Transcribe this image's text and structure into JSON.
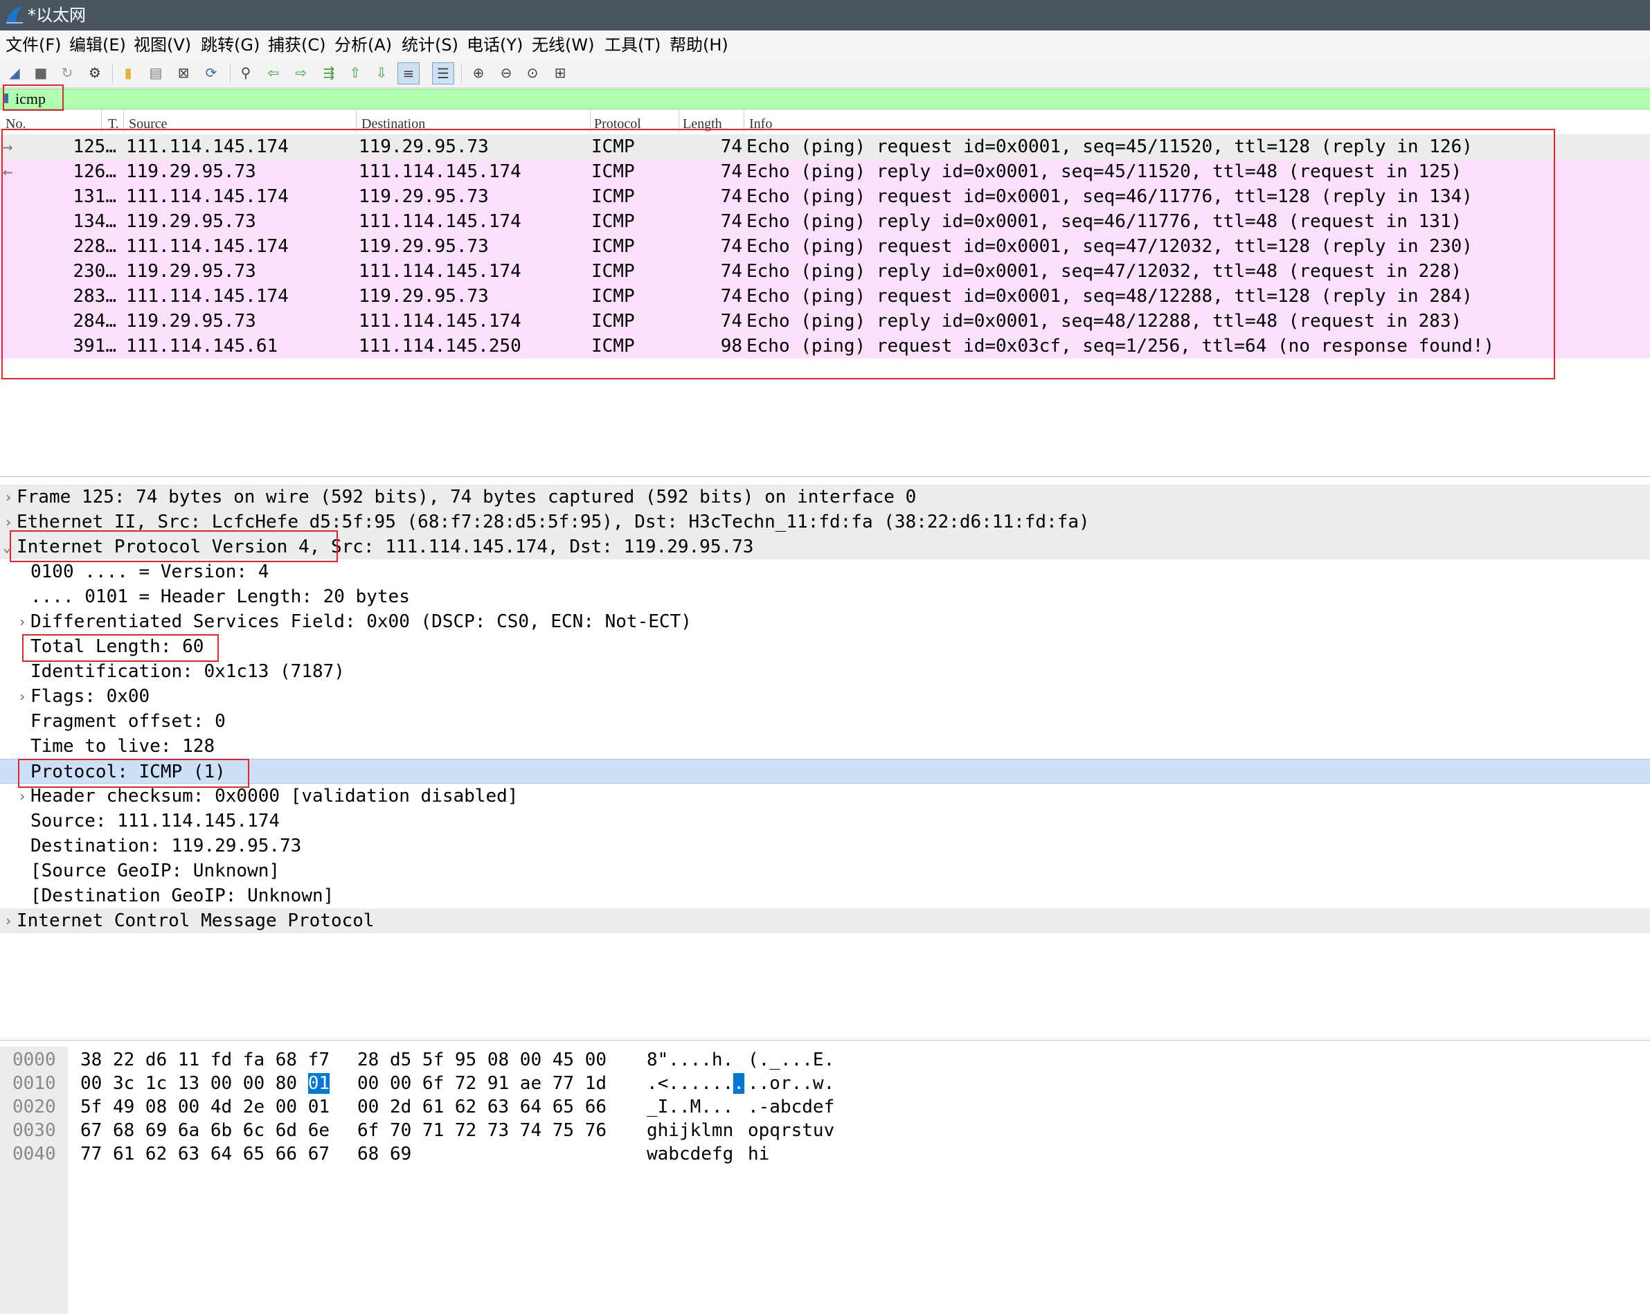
{
  "window": {
    "title": "*以太网"
  },
  "menu": [
    "文件(F)",
    "编辑(E)",
    "视图(V)",
    "跳转(G)",
    "捕获(C)",
    "分析(A)",
    "统计(S)",
    "电话(Y)",
    "无线(W)",
    "工具(T)",
    "帮助(H)"
  ],
  "toolbar": {
    "buttons": [
      "shark-fin-start-icon",
      "stop-capture-icon",
      "restart-capture-icon",
      "capture-options-icon",
      "open-file-icon",
      "save-file-icon",
      "close-file-icon",
      "reload-file-icon",
      "find-packet-icon",
      "go-back-icon",
      "go-forward-icon",
      "go-to-packet-icon",
      "first-packet-icon",
      "last-packet-icon",
      "autoscroll-icon",
      "colorize-icon",
      "zoom-in-icon",
      "zoom-out-icon",
      "normal-size-icon",
      "resize-columns-icon"
    ]
  },
  "filter": {
    "value": "icmp"
  },
  "packet_list": {
    "columns": [
      "No.",
      "T.",
      "Source",
      "Destination",
      "Protocol",
      "Length",
      "Info"
    ],
    "rows": [
      {
        "arrow": "→",
        "no": "125…",
        "source": "111.114.145.174",
        "destination": "119.29.95.73",
        "protocol": "ICMP",
        "length": "74",
        "info": "Echo (ping) request  id=0x0001, seq=45/11520, ttl=128 (reply in 126)"
      },
      {
        "arrow": "←",
        "no": "126…",
        "source": "119.29.95.73",
        "destination": "111.114.145.174",
        "protocol": "ICMP",
        "length": "74",
        "info": "Echo (ping) reply    id=0x0001, seq=45/11520, ttl=48 (request in 125)"
      },
      {
        "arrow": "",
        "no": "131…",
        "source": "111.114.145.174",
        "destination": "119.29.95.73",
        "protocol": "ICMP",
        "length": "74",
        "info": "Echo (ping) request  id=0x0001, seq=46/11776, ttl=128 (reply in 134)"
      },
      {
        "arrow": "",
        "no": "134…",
        "source": "119.29.95.73",
        "destination": "111.114.145.174",
        "protocol": "ICMP",
        "length": "74",
        "info": "Echo (ping) reply    id=0x0001, seq=46/11776, ttl=48 (request in 131)"
      },
      {
        "arrow": "",
        "no": "228…",
        "source": "111.114.145.174",
        "destination": "119.29.95.73",
        "protocol": "ICMP",
        "length": "74",
        "info": "Echo (ping) request  id=0x0001, seq=47/12032, ttl=128 (reply in 230)"
      },
      {
        "arrow": "",
        "no": "230…",
        "source": "119.29.95.73",
        "destination": "111.114.145.174",
        "protocol": "ICMP",
        "length": "74",
        "info": "Echo (ping) reply    id=0x0001, seq=47/12032, ttl=48 (request in 228)"
      },
      {
        "arrow": "",
        "no": "283…",
        "source": "111.114.145.174",
        "destination": "119.29.95.73",
        "protocol": "ICMP",
        "length": "74",
        "info": "Echo (ping) request  id=0x0001, seq=48/12288, ttl=128 (reply in 284)"
      },
      {
        "arrow": "",
        "no": "284…",
        "source": "119.29.95.73",
        "destination": "111.114.145.174",
        "protocol": "ICMP",
        "length": "74",
        "info": "Echo (ping) reply    id=0x0001, seq=48/12288, ttl=48 (request in 283)"
      },
      {
        "arrow": "",
        "no": "391…",
        "source": "111.114.145.61",
        "destination": "111.114.145.250",
        "protocol": "ICMP",
        "length": "98",
        "info": "Echo (ping) request  id=0x03cf, seq=1/256, ttl=64 (no response found!)"
      }
    ]
  },
  "details": [
    {
      "expander": "›",
      "text": "Frame 125: 74 bytes on wire (592 bits), 74 bytes captured (592 bits) on interface 0"
    },
    {
      "expander": "›",
      "text": "Ethernet II, Src: LcfcHefe_d5:5f:95 (68:f7:28:d5:5f:95), Dst: H3cTechn_11:fd:fa (38:22:d6:11:fd:fa)"
    },
    {
      "expander": "⌄",
      "text": "Internet Protocol Version 4, Src: 111.114.145.174, Dst: 119.29.95.73"
    },
    {
      "expander": "",
      "text": "0100 .... = Version: 4"
    },
    {
      "expander": "",
      "text": ".... 0101 = Header Length: 20 bytes"
    },
    {
      "expander": "›",
      "text": "Differentiated Services Field: 0x00 (DSCP: CS0, ECN: Not-ECT)"
    },
    {
      "expander": "",
      "text": "Total Length: 60"
    },
    {
      "expander": "",
      "text": "Identification: 0x1c13 (7187)"
    },
    {
      "expander": "›",
      "text": "Flags: 0x00"
    },
    {
      "expander": "",
      "text": "Fragment offset: 0"
    },
    {
      "expander": "",
      "text": "Time to live: 128"
    },
    {
      "expander": "",
      "text": "Protocol: ICMP (1)"
    },
    {
      "expander": "›",
      "text": "Header checksum: 0x0000 [validation disabled]"
    },
    {
      "expander": "",
      "text": "Source: 111.114.145.174"
    },
    {
      "expander": "",
      "text": "Destination: 119.29.95.73"
    },
    {
      "expander": "",
      "text": "[Source GeoIP: Unknown]"
    },
    {
      "expander": "",
      "text": "[Destination GeoIP: Unknown]"
    },
    {
      "expander": "›",
      "text": "Internet Control Message Protocol"
    }
  ],
  "bytes": [
    {
      "offset": "0000",
      "hex1": "38 22 d6 11 fd fa 68 f7",
      "hex2": "28 d5 5f 95 08 00 45 00",
      "ascii1": "8\"....h.",
      "ascii2": "(._...E."
    },
    {
      "offset": "0010",
      "hex1_a": "00 3c 1c 13 00 00 80 ",
      "hex1_sel": "01",
      "hex2": "00 00 6f 72 91 ae 77 1d",
      "ascii1_a": ".<......",
      "ascii1_sel": ".",
      "ascii2": "..or..w."
    },
    {
      "offset": "0020",
      "hex1": "5f 49 08 00 4d 2e 00 01",
      "hex2": "00 2d 61 62 63 64 65 66",
      "ascii1": "_I..M...",
      "ascii2": ".-abcdef"
    },
    {
      "offset": "0030",
      "hex1": "67 68 69 6a 6b 6c 6d 6e",
      "hex2": "6f 70 71 72 73 74 75 76",
      "ascii1": "ghijklmn",
      "ascii2": "opqrstuv"
    },
    {
      "offset": "0040",
      "hex1": "77 61 62 63 64 65 66 67",
      "hex2": "68 69",
      "ascii1": "wabcdefg",
      "ascii2": "hi"
    }
  ],
  "colors": {
    "filter_ok": "#afffaf",
    "icmp_row": "#fbe0fb",
    "selection": "#cce0f8",
    "annotation": "#e8232a"
  }
}
